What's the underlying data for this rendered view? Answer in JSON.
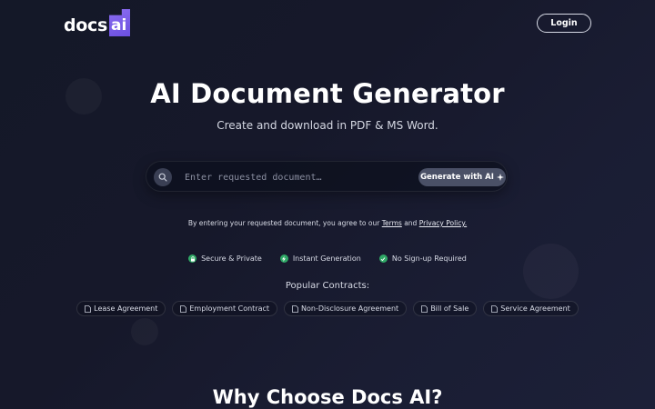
{
  "header": {
    "logo_text": "docs",
    "logo_badge": "ai",
    "login_label": "Login"
  },
  "hero": {
    "title": "AI Document Generator",
    "subtitle": "Create and download in PDF & MS Word."
  },
  "search": {
    "icon": "search-icon",
    "placeholder": "Enter requested document…",
    "button_label": "Generate with AI",
    "button_icon": "sparkle-icon"
  },
  "consent": {
    "prefix": "By entering your requested document, you agree to our",
    "terms_link": "Terms",
    "and": "and",
    "privacy_link": "Privacy Policy."
  },
  "features": [
    {
      "label": "Secure & Private",
      "icon": "lock-icon"
    },
    {
      "label": "Instant Generation",
      "icon": "lightning-icon"
    },
    {
      "label": "No Sign-up Required",
      "icon": "check-icon"
    }
  ],
  "popular": {
    "label": "Popular Contracts:",
    "chips": [
      {
        "label": "Lease Agreement",
        "icon": "document-icon"
      },
      {
        "label": "Employment Contract",
        "icon": "document-icon"
      },
      {
        "label": "Non-Disclosure Agreement",
        "icon": "document-icon"
      },
      {
        "label": "Bill of Sale",
        "icon": "document-icon"
      },
      {
        "label": "Service Agreement",
        "icon": "document-icon"
      }
    ]
  },
  "section": {
    "why_title": "Why Choose Docs AI?"
  },
  "colors": {
    "background": "#16182a",
    "accent": "#7b5ff0",
    "feature_dot": "#2fa866",
    "button": "#4a5066"
  }
}
